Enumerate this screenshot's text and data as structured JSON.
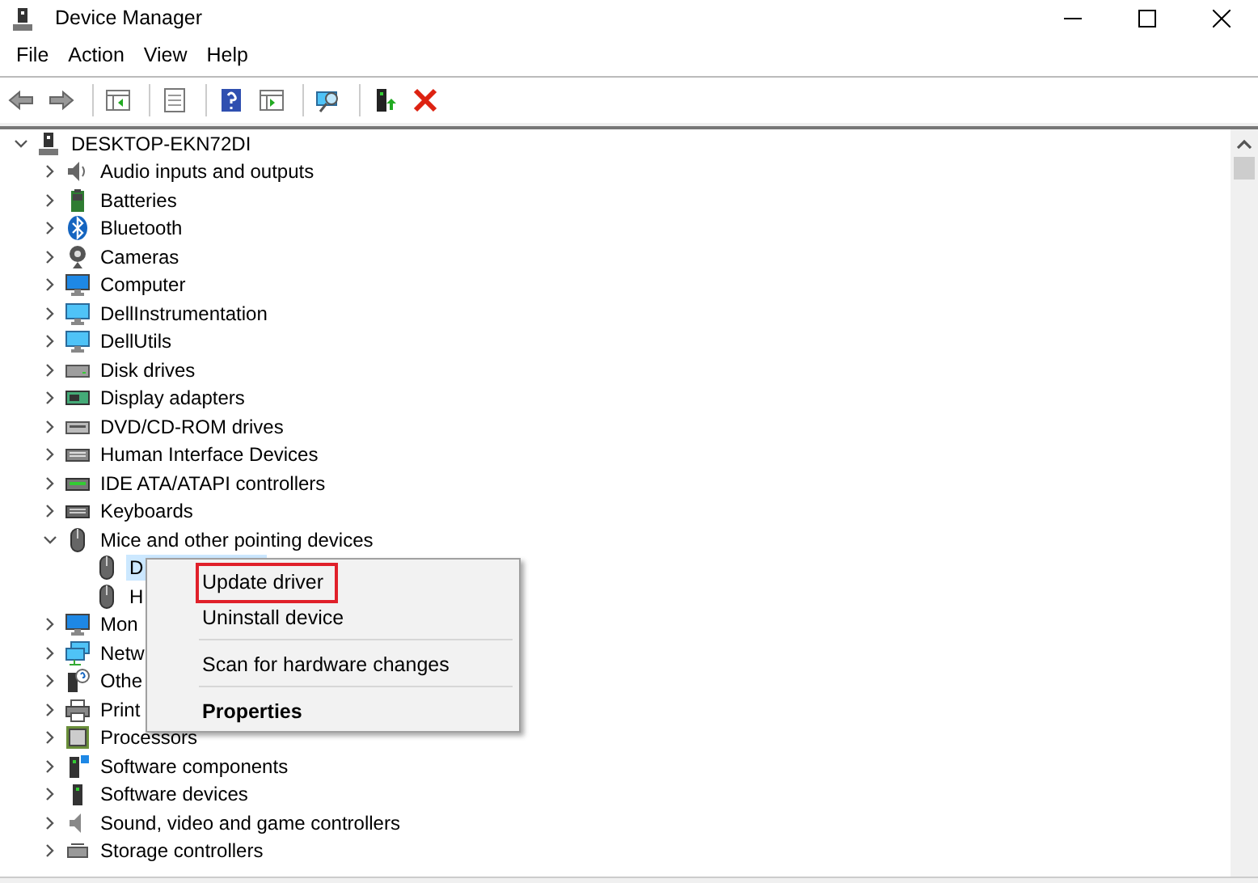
{
  "window": {
    "title": "Device Manager"
  },
  "menu_bar": [
    "File",
    "Action",
    "View",
    "Help"
  ],
  "tree": {
    "label": "DESKTOP-EKN72DI",
    "expanded": true,
    "selected": false,
    "children": [
      {
        "label": "Audio inputs and outputs",
        "expanded": false,
        "selected": false
      },
      {
        "label": "Batteries",
        "expanded": false,
        "selected": false
      },
      {
        "label": "Bluetooth",
        "expanded": false,
        "selected": false
      },
      {
        "label": "Cameras",
        "expanded": false,
        "selected": false
      },
      {
        "label": "Computer",
        "expanded": false,
        "selected": false
      },
      {
        "label": "DellInstrumentation",
        "expanded": false,
        "selected": false
      },
      {
        "label": "DellUtils",
        "expanded": false,
        "selected": false
      },
      {
        "label": "Disk drives",
        "expanded": false,
        "selected": false
      },
      {
        "label": "Display adapters",
        "expanded": false,
        "selected": false
      },
      {
        "label": "DVD/CD-ROM drives",
        "expanded": false,
        "selected": false
      },
      {
        "label": "Human Interface Devices",
        "expanded": false,
        "selected": false
      },
      {
        "label": "IDE ATA/ATAPI controllers",
        "expanded": false,
        "selected": false
      },
      {
        "label": "Keyboards",
        "expanded": false,
        "selected": false
      },
      {
        "label": "Mice and other pointing devices",
        "expanded": true,
        "selected": false,
        "children": [
          {
            "label": "D",
            "selected": true
          },
          {
            "label": "H",
            "selected": false
          }
        ]
      },
      {
        "label": "Mon",
        "expanded": false,
        "selected": false
      },
      {
        "label": "Netw",
        "expanded": false,
        "selected": false
      },
      {
        "label": "Othe",
        "expanded": false,
        "selected": false
      },
      {
        "label": "Print",
        "expanded": false,
        "selected": false
      },
      {
        "label": "Processors",
        "expanded": false,
        "selected": false
      },
      {
        "label": "Software components",
        "expanded": false,
        "selected": false
      },
      {
        "label": "Software devices",
        "expanded": false,
        "selected": false
      },
      {
        "label": "Sound, video and game controllers",
        "expanded": false,
        "selected": false
      },
      {
        "label": "Storage controllers",
        "expanded": false,
        "selected": false
      }
    ]
  },
  "context_menu": [
    {
      "kind": "item",
      "label": "Update driver",
      "bold": false,
      "outlined": true
    },
    {
      "kind": "item",
      "label": "Uninstall device",
      "bold": false,
      "outlined": false
    },
    {
      "kind": "separator"
    },
    {
      "kind": "item",
      "label": "Scan for hardware changes",
      "bold": false,
      "outlined": false
    },
    {
      "kind": "separator"
    },
    {
      "kind": "item",
      "label": "Properties",
      "bold": true,
      "outlined": false
    }
  ]
}
